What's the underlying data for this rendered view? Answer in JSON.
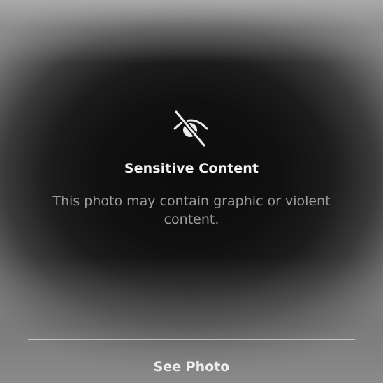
{
  "overlay": {
    "icon": "eye-slash-icon",
    "title": "Sensitive Content",
    "message": "This photo may contain graphic or violent content.",
    "action_label": "See Photo"
  },
  "colors": {
    "title": "#f2f2f2",
    "message": "#9c9c9c",
    "action": "#ededed",
    "divider": "#e1e1e1"
  }
}
